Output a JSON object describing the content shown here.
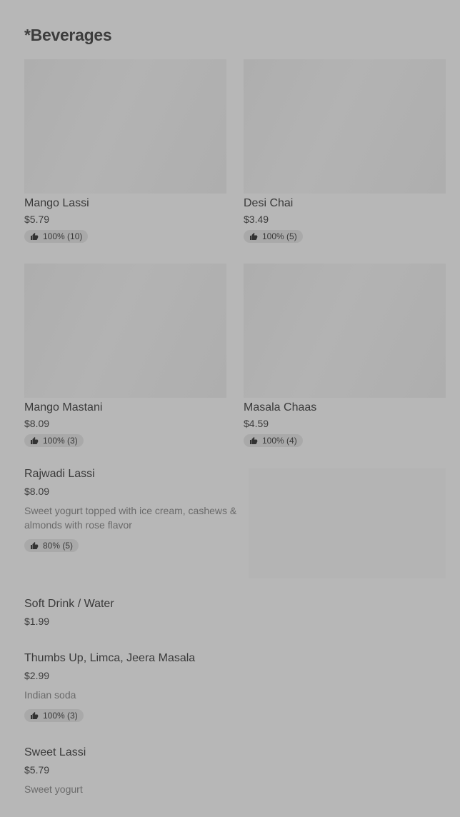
{
  "section": {
    "title": "*Beverages"
  },
  "grid_items": [
    {
      "name": "Mango Lassi",
      "price": "$5.79",
      "rating": "100% (10)"
    },
    {
      "name": "Desi Chai",
      "price": "$3.49",
      "rating": "100% (5)"
    },
    {
      "name": "Mango Mastani",
      "price": "$8.09",
      "rating": "100% (3)"
    },
    {
      "name": "Masala Chaas",
      "price": "$4.59",
      "rating": "100% (4)"
    }
  ],
  "list_items": [
    {
      "name": "Rajwadi Lassi",
      "price": "$8.09",
      "description": "Sweet yogurt topped with ice cream, cashews & almonds with rose flavor",
      "rating": "80% (5)"
    },
    {
      "name": "Soft Drink / Water",
      "price": "$1.99"
    },
    {
      "name": "Thumbs Up, Limca, Jeera Masala",
      "price": "$2.99",
      "description": "Indian soda",
      "rating": "100% (3)"
    },
    {
      "name": "Sweet Lassi",
      "price": "$5.79",
      "description": "Sweet yogurt"
    }
  ],
  "icons": {
    "rating": "thumbs-up-icon"
  }
}
